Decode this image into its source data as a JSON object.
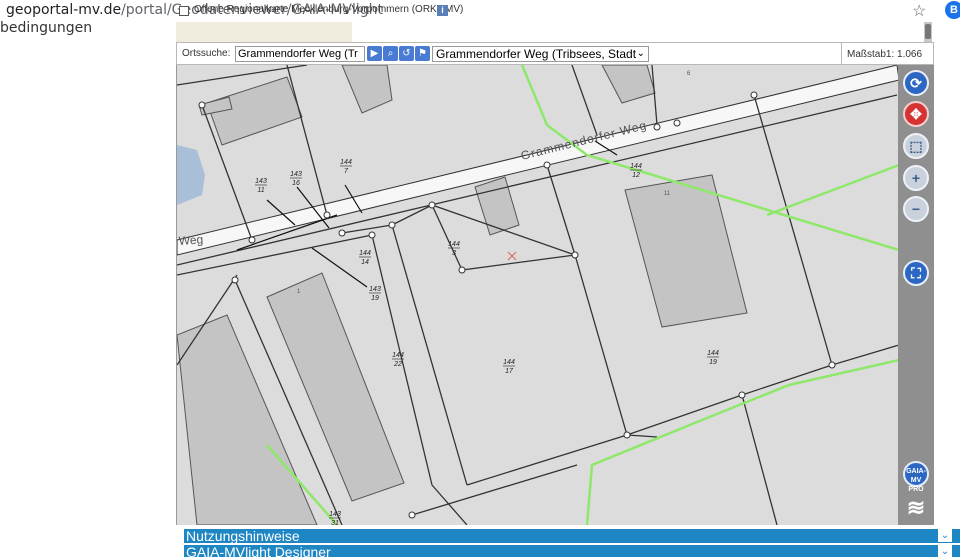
{
  "browser": {
    "url_host": "geoportal-mv.de",
    "url_path": "/portal/Geodatenviewer/GAIA-MVlight",
    "profile_initial": "B"
  },
  "page": {
    "side_text": "bedingungen"
  },
  "layers": {
    "orka_label": "Offene Regionalkarte Mecklenburg-Vorpommern (ORKa.MV)",
    "info_glyph": "i"
  },
  "search": {
    "label": "Ortssuche:",
    "value": "Grammendorfer Weg (Tr",
    "result_selected": "Grammendorfer Weg (Tribsees, Stadt",
    "scale_text": "Maßstab1: 1.066"
  },
  "map": {
    "street_label_top": "Grammendorfer Weg",
    "street_label_left": "Weg",
    "parcel_labels": [
      {
        "num": "143",
        "den": "11"
      },
      {
        "num": "143",
        "den": "16"
      },
      {
        "num": "144",
        "den": "7"
      },
      {
        "num": "144",
        "den": "14"
      },
      {
        "num": "143",
        "den": "19"
      },
      {
        "num": "144",
        "den": "3"
      },
      {
        "num": "144",
        "den": "12"
      },
      {
        "num": "144",
        "den": "22"
      },
      {
        "num": "144",
        "den": "17"
      },
      {
        "num": "144",
        "den": "19"
      },
      {
        "num": "143",
        "den": "31"
      }
    ],
    "building_numbers": [
      "1",
      "11",
      "6"
    ]
  },
  "toolbar": {
    "refresh_icon": "refresh-icon",
    "pan_icon": "pan-icon",
    "zoom_box_icon": "zoom-box-icon",
    "zoom_in_icon": "zoom-in-icon",
    "zoom_out_icon": "zoom-out-icon",
    "fullscreen_icon": "fullscreen-icon",
    "pro_label": "GAIA-MV PRO",
    "layers_icon": "layers-icon"
  },
  "panels": [
    {
      "label": "Nutzungshinweise"
    },
    {
      "label": "GAIA-MVlight Designer"
    }
  ],
  "colors": {
    "accent_blue": "#1f86c4",
    "map_bg": "#dcdcdc",
    "road": "#f5f5f5",
    "green_line": "#8ee86a"
  }
}
